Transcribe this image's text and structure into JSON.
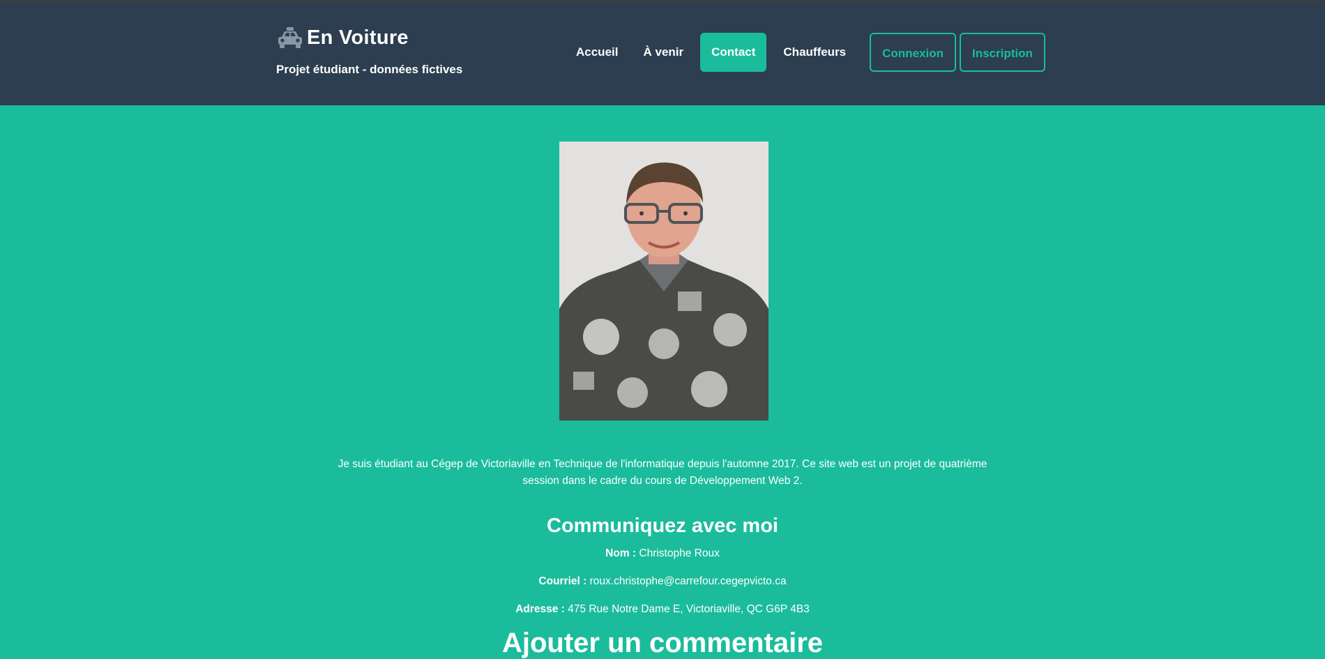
{
  "header": {
    "brand_title": "En Voiture",
    "brand_subtitle": "Projet étudiant - données fictives",
    "brand_icon": "taxi-icon"
  },
  "nav": {
    "items": [
      {
        "label": "Accueil",
        "active": false
      },
      {
        "label": "À venir",
        "active": false
      },
      {
        "label": "Contact",
        "active": true
      },
      {
        "label": "Chauffeurs",
        "active": false
      }
    ],
    "login_label": "Connexion",
    "signup_label": "Inscription"
  },
  "main": {
    "bio": "Je suis étudiant au Cégep de Victoriaville en Technique de l'informatique depuis l'automne 2017. Ce site web est un projet de quatrième session dans le cadre du cours de Développement Web 2.",
    "contact_title": "Communiquez avec moi",
    "name_label": "Nom :",
    "name_value": "Christophe Roux",
    "email_label": "Courriel :",
    "email_value": "roux.christophe@carrefour.cegepvicto.ca",
    "address_label": "Adresse :",
    "address_value": "475 Rue Notre Dame E, Victoriaville, QC G6P 4B3",
    "comment_title": "Ajouter un commentaire"
  },
  "colors": {
    "header_bg": "#2c3e50",
    "accent": "#1abc9c",
    "text": "#ffffff"
  }
}
